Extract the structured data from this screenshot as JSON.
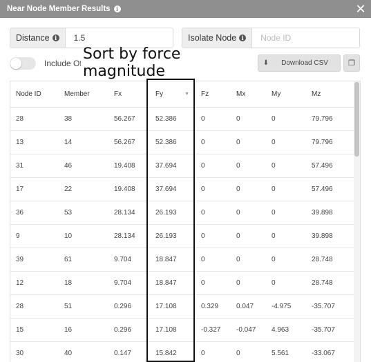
{
  "window": {
    "title": "Near Node Member Results"
  },
  "distance": {
    "label": "Distance",
    "value": "1.5"
  },
  "isolate_node": {
    "label": "Isolate Node",
    "placeholder": "Node ID"
  },
  "toggle": {
    "label": "Include Of"
  },
  "annotation": {
    "text": "Sort by force magnitude"
  },
  "download": {
    "label": "Download CSV"
  },
  "table": {
    "columns": [
      "Node ID",
      "Member",
      "Fx",
      "Fy",
      "Fz",
      "Mx",
      "My",
      "Mz"
    ],
    "rows": [
      [
        "28",
        "38",
        "56.267",
        "52.386",
        "0",
        "0",
        "0",
        "79.796"
      ],
      [
        "13",
        "14",
        "56.267",
        "52.386",
        "0",
        "0",
        "0",
        "79.796"
      ],
      [
        "31",
        "46",
        "19.408",
        "37.694",
        "0",
        "0",
        "0",
        "57.496"
      ],
      [
        "17",
        "22",
        "19.408",
        "37.694",
        "0",
        "0",
        "0",
        "57.496"
      ],
      [
        "36",
        "53",
        "28.134",
        "26.193",
        "0",
        "0",
        "0",
        "39.898"
      ],
      [
        "9",
        "10",
        "28.134",
        "26.193",
        "0",
        "0",
        "0",
        "39.898"
      ],
      [
        "39",
        "61",
        "9.704",
        "18.847",
        "0",
        "0",
        "0",
        "28.748"
      ],
      [
        "12",
        "18",
        "9.704",
        "18.847",
        "0",
        "0",
        "0",
        "28.748"
      ],
      [
        "28",
        "51",
        "0.296",
        "17.108",
        "0.329",
        "0.047",
        "-4.975",
        "-35.707"
      ],
      [
        "15",
        "16",
        "0.296",
        "17.108",
        "-0.327",
        "-0.047",
        "4.963",
        "-35.707"
      ],
      [
        "30",
        "40",
        "0.147",
        "15.842",
        "0",
        "0",
        "5.561",
        "-33.067"
      ]
    ]
  },
  "icons": {
    "info": "i",
    "close": "✕",
    "download": "⬇",
    "copy": "❐",
    "sort_caret": "▼"
  }
}
